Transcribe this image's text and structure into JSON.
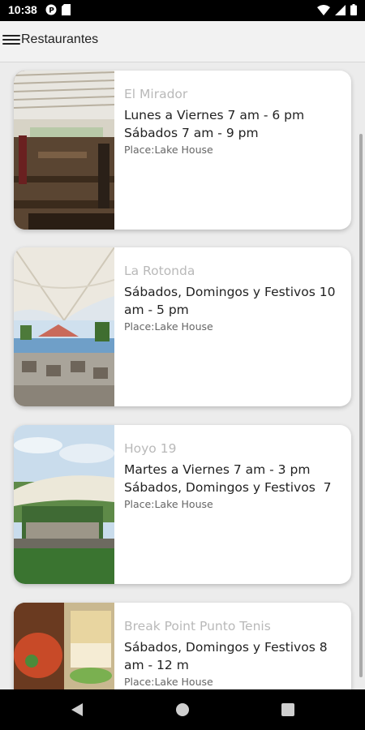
{
  "status_bar": {
    "time": "10:38",
    "left_icons": [
      "notification-p-icon",
      "sd-card-icon"
    ],
    "right_icons": [
      "wifi-icon",
      "signal-icon",
      "battery-icon"
    ]
  },
  "app_bar": {
    "title": "Restaurantes",
    "menu_icon": "hamburger-menu-icon"
  },
  "restaurants": [
    {
      "name": "El Mirador",
      "hours": "Lunes a Viernes 7 am - 6 pm\nSábados 7 am - 9 pm",
      "place": "Place:Lake House",
      "image": "terrace-dining-photo"
    },
    {
      "name": "La Rotonda",
      "hours": "Sábados, Domingos y Festivos 10 am - 5 pm",
      "place": "Place:Lake House",
      "image": "pool-canopy-photo"
    },
    {
      "name": "Hoyo 19",
      "hours": "Martes a Viernes 7 am - 3 pm\nSábados, Domingos y Festivos  7",
      "place": "Place:Lake House",
      "image": "garden-tent-photo"
    },
    {
      "name": "Break Point Punto Tenis",
      "hours": "Sábados, Domingos y Festivos 8 am - 12 m",
      "place": "Place:Lake House",
      "image": "food-plates-photo"
    }
  ],
  "nav_bar": {
    "buttons": [
      "back-triangle-icon",
      "home-circle-icon",
      "recents-square-icon"
    ]
  },
  "colors": {
    "background": "#ececec",
    "card": "#ffffff",
    "title_gray": "#b9b9b9",
    "text_dark": "#222222"
  }
}
